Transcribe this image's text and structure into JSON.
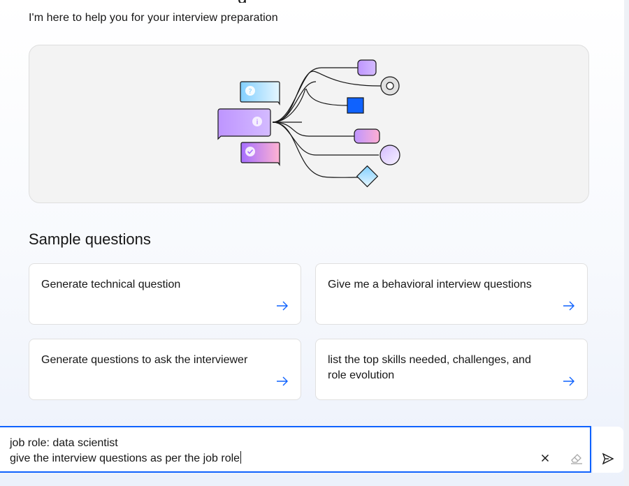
{
  "header": {
    "title_fragment": "g",
    "intro": "I'm here to help you for your interview preparation"
  },
  "hero": {
    "icons": [
      "question-bubble-icon",
      "info-bubble-icon",
      "check-bubble-icon",
      "tree-branches-icon",
      "square-icon",
      "circle-icon",
      "diamond-icon"
    ]
  },
  "samples": {
    "heading": "Sample questions",
    "items": [
      {
        "label": "Generate technical question"
      },
      {
        "label": "Give me a behavioral interview questions"
      },
      {
        "label": "Generate questions to ask the interviewer"
      },
      {
        "label": "list the top skills needed, challenges, and role evolution"
      }
    ]
  },
  "composer": {
    "line1": "job role: data scientist",
    "line2": "give the interview questions as per the job role"
  },
  "colors": {
    "accent": "#0f62fe",
    "purple": "#a56eff",
    "pink": "#ff7eb6",
    "lightblue": "#82cfff"
  }
}
